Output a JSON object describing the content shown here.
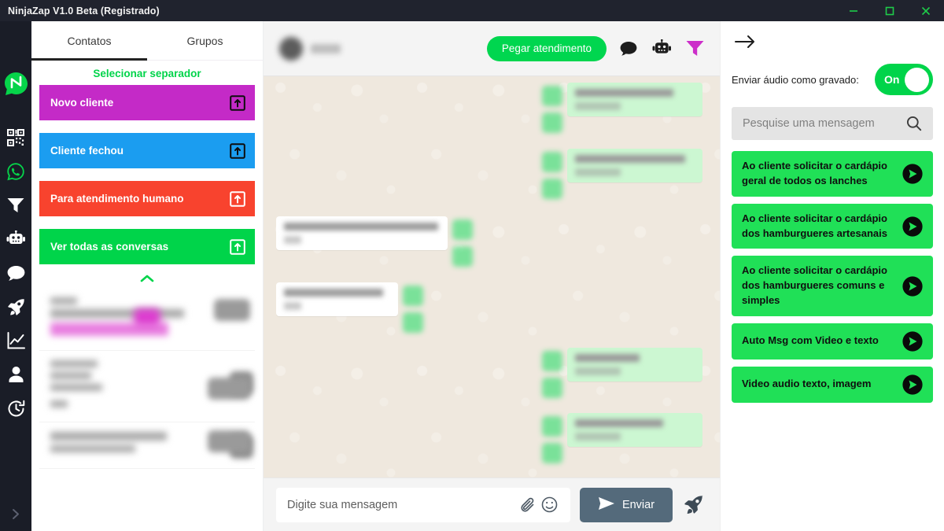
{
  "window": {
    "title": "NinjaZap V1.0 Beta (Registrado)",
    "controls": [
      {
        "name": "minimize",
        "glyph": "minimize-icon"
      },
      {
        "name": "maximize",
        "glyph": "maximize-icon"
      },
      {
        "name": "close",
        "glyph": "close-icon"
      }
    ],
    "accent_green": "#00d44a",
    "titlebar_bg": "#20232e"
  },
  "rail": {
    "logo": "ninjazap-logo",
    "icons": [
      {
        "name": "qr-code-icon"
      },
      {
        "name": "whatsapp-icon"
      },
      {
        "name": "funnel-icon"
      },
      {
        "name": "robot-icon"
      },
      {
        "name": "chat-bubble-icon"
      },
      {
        "name": "rocket-icon"
      },
      {
        "name": "chart-line-icon"
      },
      {
        "name": "person-icon"
      },
      {
        "name": "history-clock-icon"
      }
    ],
    "expand": "chevron-right-icon"
  },
  "contacts": {
    "tabs": [
      {
        "label": "Contatos",
        "active": true
      },
      {
        "label": "Grupos",
        "active": false
      }
    ],
    "section_title": "Selecionar separador",
    "separators": [
      {
        "label": "Novo cliente",
        "color": "#c42ac7"
      },
      {
        "label": "Cliente fechou",
        "color": "#1b9df0"
      },
      {
        "label": "Para atendimento humano",
        "color": "#f8432e"
      },
      {
        "label": "Ver todas as conversas",
        "color": "#00d44a"
      }
    ],
    "collapse": "chevron-up-icon",
    "rows": [
      {
        "redacted": true
      },
      {
        "redacted": true
      },
      {
        "redacted": true
      }
    ]
  },
  "chat": {
    "header": {
      "avatar": "contact-avatar",
      "name_redacted": true,
      "action_label": "Pegar atendimento",
      "icons": [
        {
          "name": "chat-bubble-icon",
          "color": "#1d1d1d"
        },
        {
          "name": "robot-icon",
          "color": "#1d1d1d"
        },
        {
          "name": "funnel-icon",
          "color": "#cc2ec9"
        }
      ]
    },
    "messages": [
      {
        "side": "out",
        "redacted": true
      },
      {
        "side": "out",
        "redacted": true
      },
      {
        "side": "in",
        "redacted": true
      },
      {
        "side": "in",
        "redacted": true
      },
      {
        "side": "out",
        "redacted": true
      },
      {
        "side": "out",
        "redacted": true
      }
    ],
    "composer": {
      "placeholder": "Digite sua mensagem",
      "value": "",
      "attach_icon": "paperclip-icon",
      "emoji_icon": "smiley-icon",
      "send_label": "Enviar",
      "send_icon": "send-plane-icon",
      "rocket_icon": "rocket-icon"
    }
  },
  "right_panel": {
    "back_icon": "arrow-right-icon",
    "toggle": {
      "label": "Enviar áudio como gravado:",
      "state": "On",
      "color": "#00d44a"
    },
    "search": {
      "placeholder": "Pesquise uma mensagem",
      "value": "",
      "icon": "search-icon"
    },
    "quick_messages": [
      {
        "text": "Ao cliente solicitar o cardápio geral de todos os lanches",
        "send_icon": "send-circle-icon"
      },
      {
        "text": "Ao cliente solicitar o cardápio dos hamburgueres artesanais",
        "send_icon": "send-circle-icon"
      },
      {
        "text": "Ao cliente solicitar o cardápio dos hamburgueres comuns e simples",
        "send_icon": "send-circle-icon"
      },
      {
        "text": "Auto Msg com Video e texto",
        "send_icon": "send-circle-icon"
      },
      {
        "text": "Video audio texto, imagem",
        "send_icon": "send-circle-icon"
      }
    ]
  }
}
